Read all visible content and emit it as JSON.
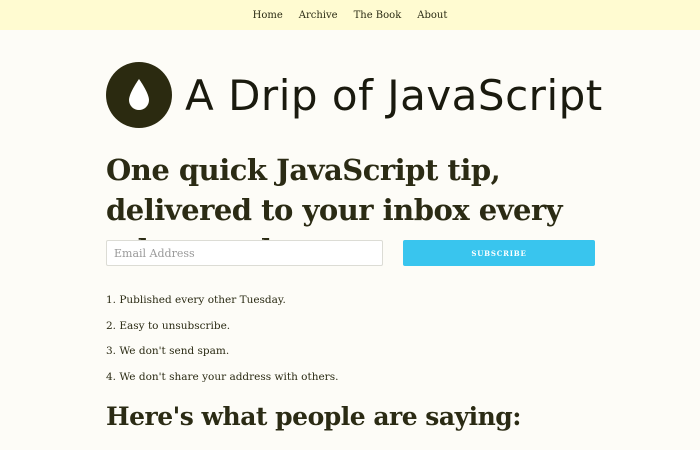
{
  "nav": {
    "items": [
      {
        "label": "Home"
      },
      {
        "label": "Archive"
      },
      {
        "label": "The Book"
      },
      {
        "label": "About"
      }
    ]
  },
  "brand": {
    "title": "A Drip of JavaScript",
    "logo_icon": "water-drop-icon",
    "logo_color": "#2b2a10"
  },
  "tagline": "One quick JavaScript tip, delivered to your inbox every other week.",
  "signup": {
    "email_placeholder": "Email Address",
    "subscribe_label": "SUBSCRIBE",
    "button_color": "#39c5ee"
  },
  "benefits": [
    "1. Published every other Tuesday.",
    "2. Easy to unsubscribe.",
    "3. We don't send spam.",
    "4. We don't share your address with others."
  ],
  "testimonials_heading": "Here's what people are saying:"
}
